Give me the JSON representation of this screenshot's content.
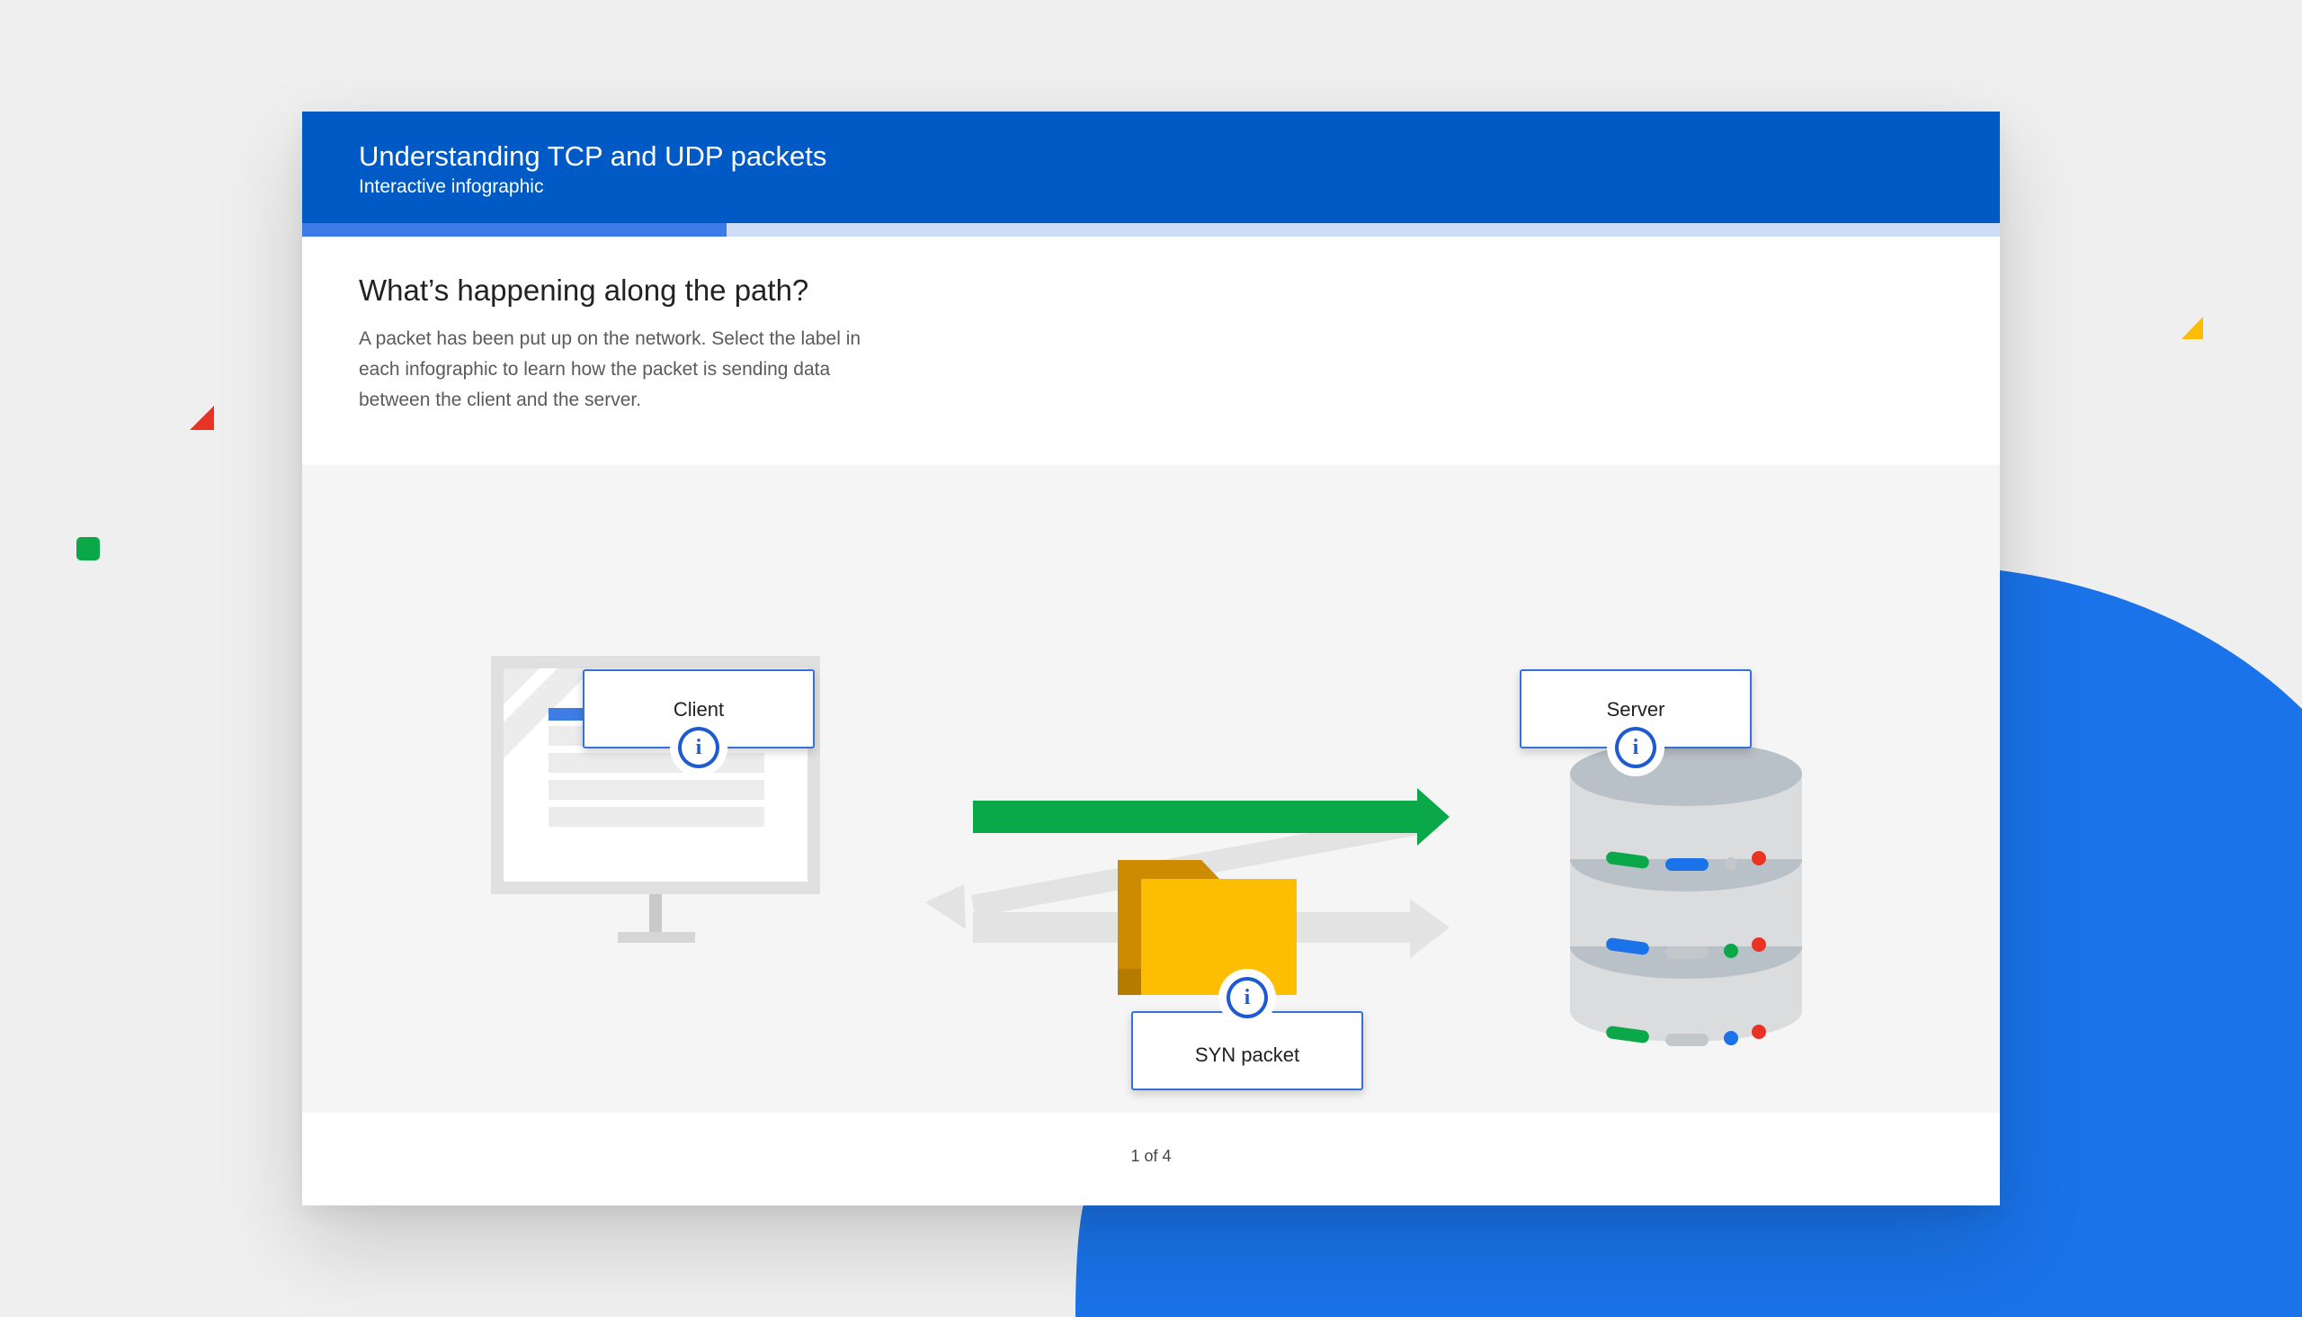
{
  "header": {
    "title": "Understanding TCP and UDP packets",
    "subtitle": "Interactive infographic"
  },
  "progress": {
    "fraction": 0.25
  },
  "intro": {
    "heading": "What’s happening along the path?",
    "description": "A packet has been put up on the network. Select the label in each infographic to learn how the packet is sending data between the client and the server."
  },
  "diagram": {
    "labels": {
      "client": "Client",
      "server": "Server",
      "packet": "SYN packet"
    },
    "info_icon": "info-icon"
  },
  "footer": {
    "page_counter": "1 of 4"
  },
  "colors": {
    "header_blue": "#005ac5",
    "accent_blue": "#1a73e8",
    "green": "#0aa848",
    "yellow": "#fbbc04",
    "red": "#ea3323",
    "folder_gold": "#fdbd00"
  }
}
